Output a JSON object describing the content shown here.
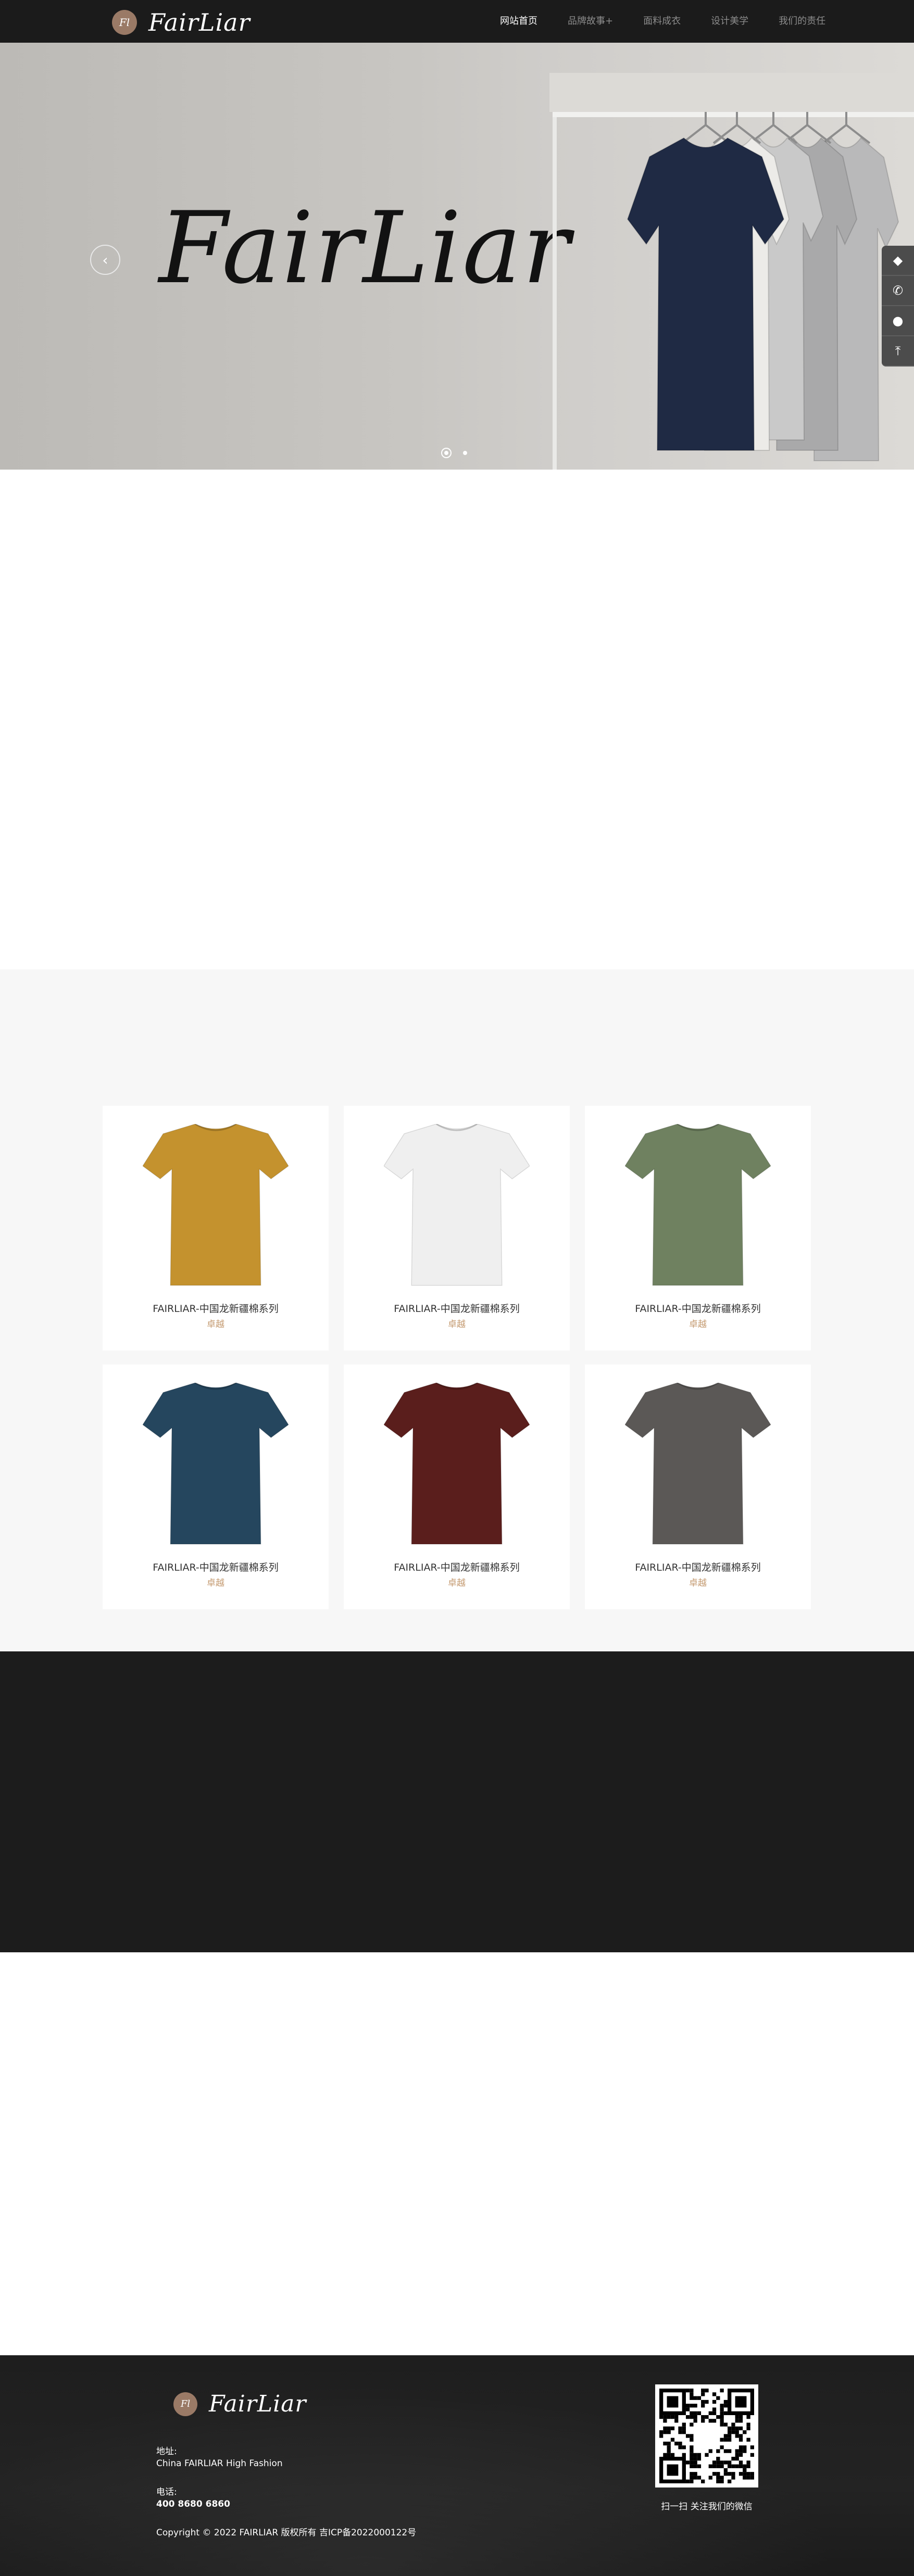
{
  "header": {
    "logo_badge": "Fl",
    "logo_text": "FairLiar",
    "nav": [
      {
        "label": "网站首页",
        "active": true
      },
      {
        "label": "品牌故事+",
        "active": false
      },
      {
        "label": "面料成衣",
        "active": false
      },
      {
        "label": "设计美学",
        "active": false
      },
      {
        "label": "我们的责任",
        "active": false
      }
    ]
  },
  "hero": {
    "brand": "FairLiar",
    "prev_icon": "chevron-left-icon",
    "prev_glyph": "‹",
    "slides": 2,
    "active_slide": 1,
    "shirt_colors": [
      "#1f2a44",
      "#ecebe8",
      "#c9c9c9",
      "#a9a9aa",
      "#b9b9ba"
    ]
  },
  "side_tools": [
    {
      "icon": "qq-icon",
      "glyph": "◆"
    },
    {
      "icon": "phone-icon",
      "glyph": "✆"
    },
    {
      "icon": "wechat-icon",
      "glyph": "●"
    },
    {
      "icon": "back-to-top-icon",
      "glyph": "⤒"
    }
  ],
  "products": [
    {
      "title": "FAIRLIAR-中国龙新疆棉系列",
      "sub": "卓越",
      "color": "#c4922e"
    },
    {
      "title": "FAIRLIAR-中国龙新疆棉系列",
      "sub": "卓越",
      "color": "#efefef"
    },
    {
      "title": "FAIRLIAR-中国龙新疆棉系列",
      "sub": "卓越",
      "color": "#6f8160"
    },
    {
      "title": "FAIRLIAR-中国龙新疆棉系列",
      "sub": "卓越",
      "color": "#25465e"
    },
    {
      "title": "FAIRLIAR-中国龙新疆棉系列",
      "sub": "卓越",
      "color": "#5a1e1c"
    },
    {
      "title": "FAIRLIAR-中国龙新疆棉系列",
      "sub": "卓越",
      "color": "#5b5856"
    }
  ],
  "footer": {
    "logo_text": "FairLiar",
    "logo_badge": "Fl",
    "address_label": "地址:",
    "address_value": "China FAIRLIAR High Fashion",
    "phone_label": "电话:",
    "phone_value": "400 8680 6860",
    "copyright": "Copyright © 2022 FAIRLIAR 版权所有 吉ICP备2022000122号",
    "qr_caption": "扫一扫 关注我们的微信"
  },
  "colors": {
    "accent": "#c49a70",
    "dark": "#1b1b1b",
    "section_bg": "#f7f7f7"
  }
}
